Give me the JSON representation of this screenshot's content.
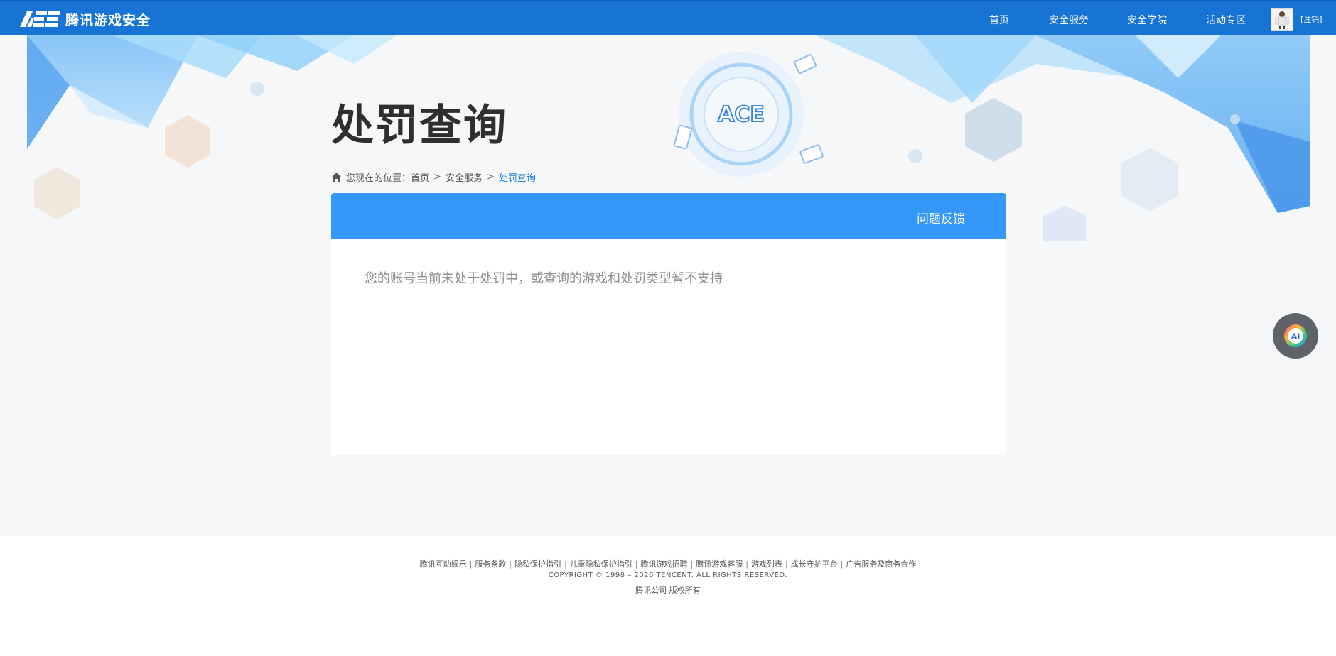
{
  "header": {
    "logo_text": "腾讯游戏安全",
    "nav": [
      {
        "label": "首页"
      },
      {
        "label": "安全服务"
      },
      {
        "label": "安全学院"
      },
      {
        "label": "活动专区"
      }
    ],
    "logout_label": "[注销]",
    "brand_color": "#1874d4"
  },
  "banner": {
    "title": "处罚查询",
    "badge_icon": "ace-logo-icon"
  },
  "breadcrumb": {
    "prefix": "您现在的位置：",
    "items": [
      "首页",
      "安全服务"
    ],
    "current": "处罚查询",
    "separator": ">"
  },
  "panel": {
    "feedback_label": "问题反馈",
    "message": "您的账号当前未处于处罚中，或查询的游戏和处罚类型暂不支持",
    "header_color": "#3598f8"
  },
  "ai_button": {
    "icon": "ai-assistant-icon"
  },
  "footer": {
    "links": [
      "腾讯互动娱乐",
      "服务条款",
      "隐私保护指引",
      "儿童隐私保护指引",
      "腾讯游戏招聘",
      "腾讯游戏客服",
      "游戏列表",
      "成长守护平台",
      "广告服务及商务合作"
    ],
    "separator": "|",
    "copyright": "COPYRIGHT © 1998 – 2026 TENCENT. ALL RIGHTS RESERVED.",
    "rights": "腾讯公司 版权所有"
  }
}
